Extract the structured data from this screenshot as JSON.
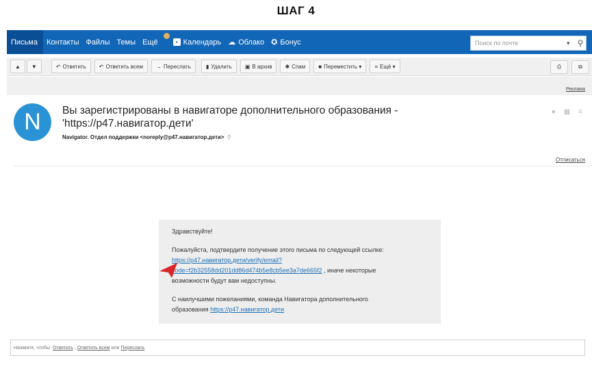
{
  "step_title": "ШАГ 4",
  "nav": {
    "items": [
      "Письма",
      "Контакты",
      "Файлы",
      "Темы",
      "Ещё"
    ],
    "apps": [
      "Календарь",
      "Облако",
      "Бонус"
    ],
    "search_placeholder": "Поиск по почте",
    "accent": "#1266b7"
  },
  "toolbar": {
    "up": "▲",
    "down": "▼",
    "reply": "Ответить",
    "reply_all": "Ответить всем",
    "forward": "Переслать",
    "delete": "Удалить",
    "archive": "В архив",
    "spam": "Спам",
    "move": "Переместить ▾",
    "more": "Ещё ▾"
  },
  "ad_label": "Реклама",
  "message": {
    "avatar_letter": "N",
    "subject": "Вы зарегистрированы в навигаторе дополнительного образования - 'https://p47.навигатор.дети'",
    "sender": "Navigator. Отдел поддержки <noreply@p47.навигатор.дети>",
    "unsubscribe": "Отписаться"
  },
  "body": {
    "greeting": "Здравствуйте!",
    "confirm_text": "Пожалуйста, подтвердите получение этого письма по следующей ссылке:",
    "link_line1": "https://p47.навигатор.дети/verify/email?",
    "link_line2": "code=f2b32558dd201dd86d474b5e8cb5ee3a7de665f2",
    "after_link": ", иначе некоторые",
    "warning_cont": "возможности будут вам недоступны.",
    "signoff": "С наилучшими пожеланиями, команда Навигатора дополнительного",
    "signoff2": "образования",
    "site_link": "https://p47.навигатор.дети"
  },
  "reply_box": {
    "prefix": "Нажмите, чтобы",
    "reply": "Ответить",
    "sep": ",",
    "reply_all": "Ответить всем",
    "or": "или",
    "forward": "Переслать"
  }
}
